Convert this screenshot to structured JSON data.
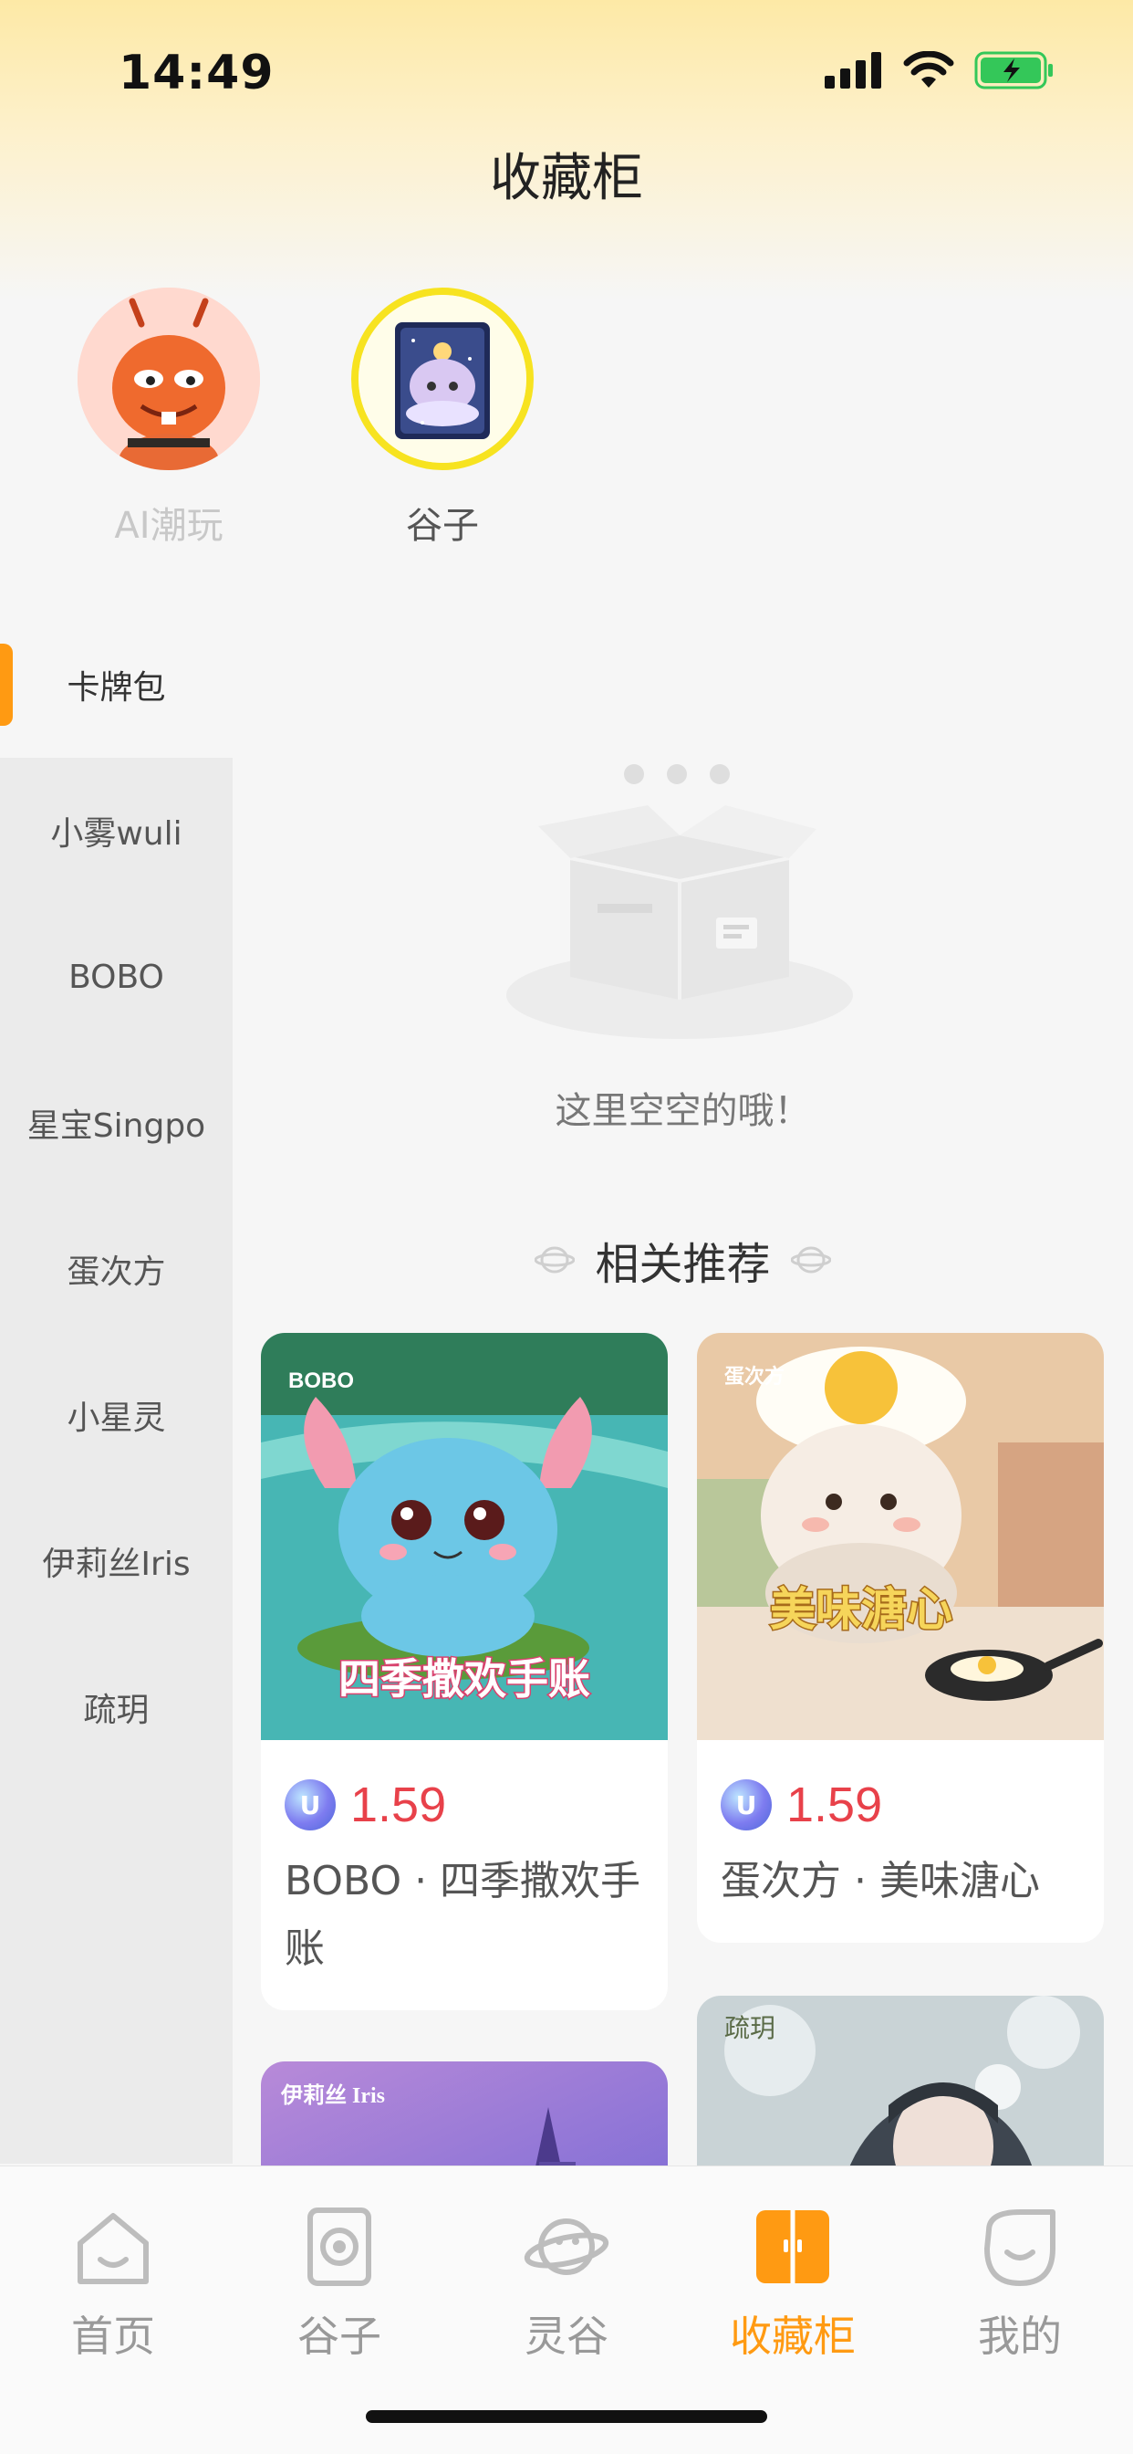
{
  "status": {
    "time": "14:49"
  },
  "header": {
    "title": "收藏柜"
  },
  "categories": [
    {
      "label": "AI潮玩",
      "selected": false
    },
    {
      "label": "谷子",
      "selected": true
    }
  ],
  "sidebar": {
    "active": "卡牌包",
    "items": [
      "小雾wuli",
      "BOBO",
      "星宝Singpo",
      "蛋次方",
      "小星灵",
      "伊莉丝Iris",
      "疏玥"
    ]
  },
  "empty_state": {
    "text": "这里空空的哦！"
  },
  "recommend": {
    "title": "相关推荐",
    "cards": [
      {
        "price": "1.59",
        "name": "BOBO · 四季撒欢手账",
        "image_caption": "四季撒欢手账",
        "image_brand": "BOBO"
      },
      {
        "price": "1.59",
        "name": "蛋次方 · 美味溏心",
        "image_caption": "美味溏心",
        "image_brand": "蛋次方"
      },
      {
        "image_brand": "伊莉丝 Iris"
      },
      {
        "image_brand": "疏玥"
      }
    ]
  },
  "tabbar": {
    "items": [
      {
        "label": "首页",
        "icon": "home-icon"
      },
      {
        "label": "谷子",
        "icon": "guzi-icon"
      },
      {
        "label": "灵谷",
        "icon": "planet-icon"
      },
      {
        "label": "收藏柜",
        "icon": "cabinet-icon",
        "active": true
      },
      {
        "label": "我的",
        "icon": "profile-icon"
      }
    ]
  },
  "colors": {
    "accent": "#ff9a12",
    "price": "#e8414a",
    "selected_ring": "#f7e320"
  }
}
